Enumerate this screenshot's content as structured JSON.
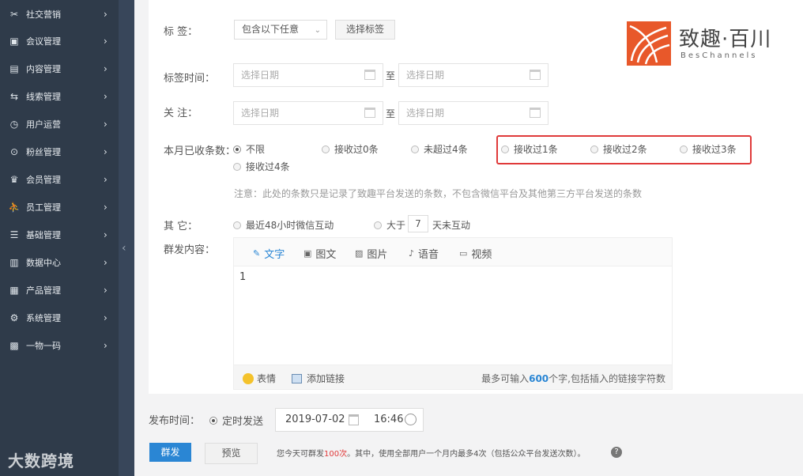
{
  "sidebar": {
    "items": [
      {
        "label": "社交营销",
        "icon": "tools-icon",
        "glyph": "✂"
      },
      {
        "label": "会议管理",
        "icon": "meeting-icon",
        "glyph": "▣"
      },
      {
        "label": "内容管理",
        "icon": "content-icon",
        "glyph": "▤"
      },
      {
        "label": "线索管理",
        "icon": "leads-icon",
        "glyph": "⇆"
      },
      {
        "label": "用户运营",
        "icon": "clock-icon",
        "glyph": "◷"
      },
      {
        "label": "粉丝管理",
        "icon": "fans-icon",
        "glyph": "⊙"
      },
      {
        "label": "会员管理",
        "icon": "crown-icon",
        "glyph": "♛"
      },
      {
        "label": "员工管理",
        "icon": "staff-icon",
        "glyph": "⛹"
      },
      {
        "label": "基础管理",
        "icon": "base-icon",
        "glyph": "☰"
      },
      {
        "label": "数据中心",
        "icon": "chart-icon",
        "glyph": "▥"
      },
      {
        "label": "产品管理",
        "icon": "grid-icon",
        "glyph": "▦"
      },
      {
        "label": "系统管理",
        "icon": "gear-icon",
        "glyph": "⚙"
      },
      {
        "label": "一物一码",
        "icon": "qr-icon",
        "glyph": "▩"
      }
    ],
    "chevron": "›",
    "collapse": "‹",
    "watermark": "大数跨境"
  },
  "logo": {
    "cn": "致趣·百川",
    "en": "BesChannels"
  },
  "form": {
    "tag_label": "标  签：",
    "tag_select": "包含以下任意",
    "tag_select_caret": "⌄",
    "choose_tag_button": "选择标签",
    "tag_time_label": "标签时间：",
    "follow_label": "关  注：",
    "date_placeholder": "选择日期",
    "to": "至",
    "received_label": "本月已收条数：",
    "received_options": [
      "不限",
      "接收过0条",
      "未超过4条",
      "接收过1条",
      "接收过2条",
      "接收过3条",
      "接收过4条"
    ],
    "received_selected": 0,
    "note": "注意：此处的条数只是记录了致趣平台发送的条数，不包含微信平台及其他第三方平台发送的条数",
    "other_label": "其  它：",
    "other_opt1": "最近48小时微信互动",
    "other_opt2_prefix": "大于",
    "other_days": "7",
    "other_opt2_suffix": "天未互动",
    "content_label": "群发内容："
  },
  "editor": {
    "tabs": [
      {
        "label": "文字",
        "icon": "pencil-icon",
        "glyph": "✎"
      },
      {
        "label": "图文",
        "icon": "news-icon",
        "glyph": "▣"
      },
      {
        "label": "图片",
        "icon": "image-icon",
        "glyph": "▨"
      },
      {
        "label": "语音",
        "icon": "mic-icon",
        "glyph": "♪"
      },
      {
        "label": "视频",
        "icon": "video-icon",
        "glyph": "▭"
      }
    ],
    "active_tab": 0,
    "body": "1",
    "emoji_label": "表情",
    "link_label": "添加链接",
    "count_prefix": "最多可输入",
    "count_value": "600",
    "count_suffix": "个字,包括插入的链接字符数"
  },
  "publish": {
    "label": "发布时间：",
    "option": "定时发送",
    "date": "2019-07-02",
    "time": "16:46",
    "send_button": "群发",
    "preview_button": "预览",
    "limit_prefix": "您今天可群发",
    "limit_value": "100次",
    "limit_suffix": "。其中，使用全部用户一个月内最多4次（包括公众平台发送次数）。",
    "help": "?"
  },
  "colors": {
    "accent": "#2a86d4",
    "highlight_border": "#e03a3a",
    "sidebar_bg": "#2f3b4a"
  }
}
